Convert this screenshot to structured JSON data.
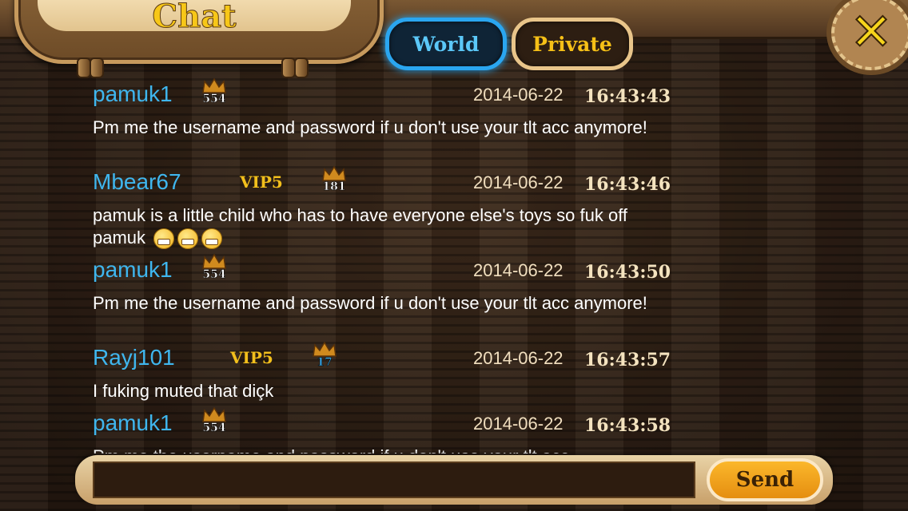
{
  "header": {
    "title": "Chat",
    "tabs": [
      {
        "label": "World",
        "active": true
      },
      {
        "label": "Private",
        "active": false
      }
    ],
    "close_icon": "close-x-icon"
  },
  "messages": [
    {
      "username": "pamuk1",
      "vip": "",
      "rank": "554",
      "date": "2014-06-22",
      "time": "16:43:43",
      "text": "Pm me the username and password if u don't use your tlt acc anymore!"
    },
    {
      "username": "Mbear67",
      "vip": "VIP5",
      "rank": "181",
      "date": "2014-06-22",
      "time": "16:43:46",
      "text": "pamuk is a little child who has to have everyone else's toys so fuk off pamuk"
    },
    {
      "username": "pamuk1",
      "vip": "",
      "rank": "554",
      "date": "2014-06-22",
      "time": "16:43:50",
      "text": "Pm me the username and password if u don't use your tlt acc anymore!"
    },
    {
      "username": "Rayj101",
      "vip": "VIP5",
      "rank": "17",
      "date": "2014-06-22",
      "time": "16:43:57",
      "text": "I fuking muted that diçk"
    },
    {
      "username": "pamuk1",
      "vip": "",
      "rank": "554",
      "date": "2014-06-22",
      "time": "16:43:58",
      "text": "Pm me the username and password if u don't use your tlt acc"
    }
  ],
  "composer": {
    "input_value": "",
    "send_label": "Send"
  },
  "colors": {
    "username": "#3fb6ee",
    "vip": "#f2bf1c",
    "world_tab_border": "#2aa6f0",
    "send_button": "#f3a51d"
  }
}
